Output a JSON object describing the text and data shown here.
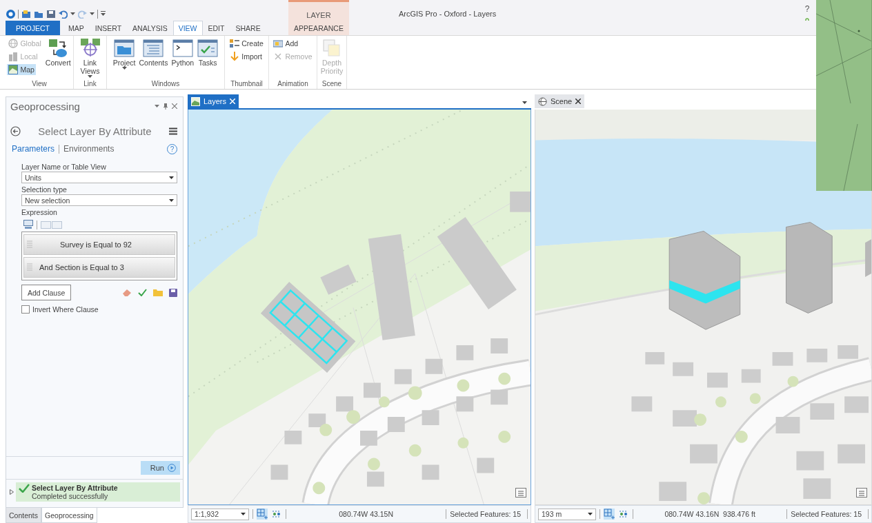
{
  "window": {
    "title": "ArcGIS Pro - Oxford - Layers",
    "help": "?"
  },
  "contextual_group": {
    "label": "LAYER"
  },
  "tabs": [
    {
      "label": "PROJECT",
      "kind": "backstage",
      "selected": false
    },
    {
      "label": "MAP",
      "kind": "tab",
      "selected": false
    },
    {
      "label": "INSERT",
      "kind": "tab",
      "selected": false
    },
    {
      "label": "ANALYSIS",
      "kind": "tab",
      "selected": false
    },
    {
      "label": "VIEW",
      "kind": "tab",
      "selected": true
    },
    {
      "label": "EDIT",
      "kind": "tab",
      "selected": false
    },
    {
      "label": "SHARE",
      "kind": "tab",
      "selected": false
    },
    {
      "label": "APPEARANCE",
      "kind": "contextual",
      "selected": false
    }
  ],
  "ribbon": {
    "groups": [
      {
        "label": "View",
        "modes": [
          {
            "label": "Global",
            "disabled": true,
            "selected": false
          },
          {
            "label": "Local",
            "disabled": true,
            "selected": false
          },
          {
            "label": "Map",
            "disabled": false,
            "selected": true
          }
        ],
        "buttons": [
          {
            "label": "Convert",
            "kind": "large",
            "disabled": false,
            "dropdown": false
          }
        ]
      },
      {
        "label": "Link",
        "buttons": [
          {
            "label": "Link Views",
            "kind": "large",
            "disabled": false,
            "dropdown": true
          }
        ]
      },
      {
        "label": "Windows",
        "buttons": [
          {
            "label": "Project",
            "kind": "large",
            "disabled": false,
            "dropdown": true
          },
          {
            "label": "Contents",
            "kind": "large",
            "disabled": false,
            "dropdown": false
          },
          {
            "label": "Python",
            "kind": "large",
            "disabled": false,
            "dropdown": false
          },
          {
            "label": "Tasks",
            "kind": "large",
            "disabled": false,
            "dropdown": false
          }
        ]
      },
      {
        "label": "Thumbnail",
        "buttons": [
          {
            "label": "Create",
            "kind": "small",
            "disabled": false,
            "dropdown": false
          },
          {
            "label": "Import",
            "kind": "small",
            "disabled": false,
            "dropdown": false
          }
        ]
      },
      {
        "label": "Animation",
        "buttons": [
          {
            "label": "Add",
            "kind": "small",
            "disabled": false,
            "dropdown": false
          },
          {
            "label": "Remove",
            "kind": "small",
            "disabled": true,
            "dropdown": false
          }
        ]
      },
      {
        "label": "Scene",
        "buttons": [
          {
            "label": "Depth Priority",
            "kind": "large",
            "disabled": true,
            "dropdown": false
          }
        ]
      }
    ]
  },
  "geoprocessing": {
    "title": "Geoprocessing",
    "tool": "Select Layer By Attribute",
    "tabs": [
      {
        "label": "Parameters",
        "selected": true
      },
      {
        "label": "Environments",
        "selected": false
      }
    ],
    "help": "?",
    "fields": [
      {
        "label": "Layer Name or Table View",
        "value": "Units"
      },
      {
        "label": "Selection type",
        "value": "New selection"
      }
    ],
    "expression": {
      "label": "Expression",
      "clauses": [
        "Survey is Equal to 92",
        "And Section is Equal to 3"
      ],
      "add_button": "Add Clause"
    },
    "invert": {
      "label": "Invert Where Clause",
      "checked": false
    },
    "run": "Run",
    "message": {
      "title": "Select Layer By Attribute",
      "status": "Completed successfully",
      "expanded": false
    }
  },
  "dock_tabs": [
    {
      "label": "Contents",
      "selected": false
    },
    {
      "label": "Geoprocessing",
      "selected": true
    }
  ],
  "views": [
    {
      "title": "Layers",
      "selected": true,
      "kind": "map",
      "scale": "1:1,932",
      "coordinates": "080.74W 43.15N",
      "selected_features": "Selected Features: 15"
    },
    {
      "title": "Scene",
      "selected": false,
      "kind": "scene",
      "scale": "193 m",
      "coordinates": "080.74W 43.16N",
      "elevation": "938.476 ft",
      "selected_features": "Selected Features: 15"
    }
  ]
}
